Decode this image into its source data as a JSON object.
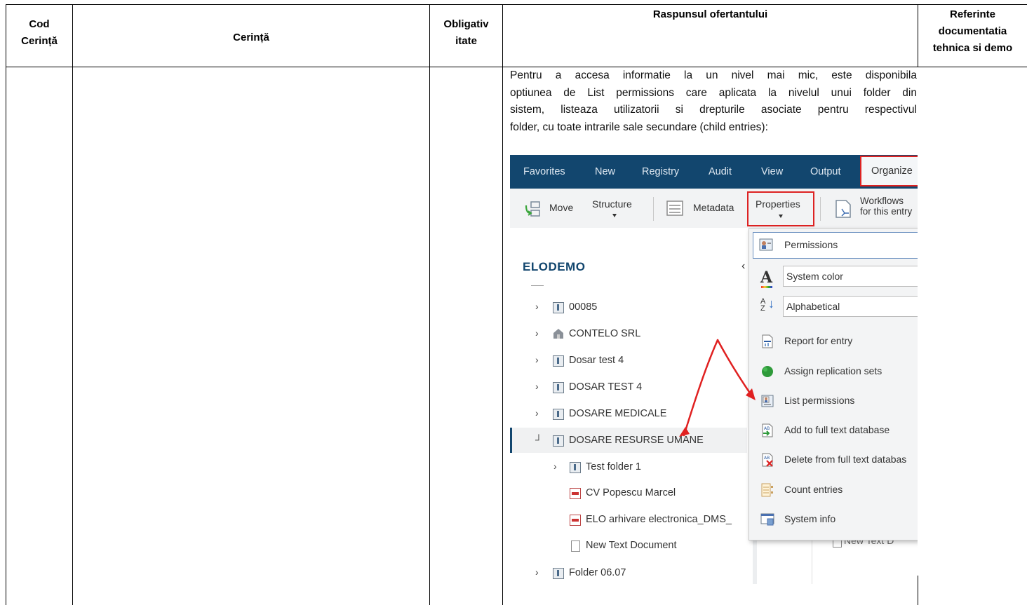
{
  "table": {
    "headers": {
      "cod": "Cod Cerință",
      "cerinta": "Cerință",
      "obligativ": "Obligativ itate",
      "raspuns": "Raspunsul ofertantului",
      "referinte": "Referinte documentatia tehnica si demo"
    },
    "header_lines": {
      "cod_1": "Cod",
      "cod_2": "Cerință",
      "obl_1": "Obligativ",
      "obl_2": "itate",
      "ref_1": "Referinte",
      "ref_2": "documentatia",
      "ref_3": "tehnica si demo"
    },
    "response_text": [
      "Pentru a accesa informatie la un nivel mai mic, este disponibila",
      "optiunea de List permissions care aplicata la nivelul unui folder din",
      "sistem, listeaza utilizatorii si drepturile asociate pentru respectivul",
      "folder, cu toate intrarile sale secundare (child entries):"
    ]
  },
  "screenshot": {
    "menubar": [
      "Favorites",
      "New",
      "Registry",
      "Audit",
      "View",
      "Output",
      "Organize"
    ],
    "ribbon": {
      "move": "Move",
      "structure": "Structure",
      "metadata": "Metadata",
      "properties": "Properties",
      "workflows_1": "Workflows",
      "workflows_2": "for this entry"
    },
    "repository": "ELODEMO",
    "tree": [
      "00085",
      "CONTELO SRL",
      "Dosar test 4",
      "DOSAR TEST 4",
      "DOSARE MEDICALE",
      "DOSARE RESURSE UMANE",
      "Test folder 1",
      "CV Popescu Marcel",
      "ELO arhivare electronica_DMS_",
      "New Text Document",
      "Folder 06.07"
    ],
    "menu": [
      "Permissions",
      "System color",
      "Alphabetical",
      "Report for entry",
      "Assign replication sets",
      "List permissions",
      "Add to full text database",
      "Delete from full text databas",
      "Count entries",
      "System info"
    ],
    "right_text": "New Text D",
    "colors": {
      "menubar": "#12466e",
      "highlight": "#dd2222",
      "arrow": "#e02020"
    }
  }
}
